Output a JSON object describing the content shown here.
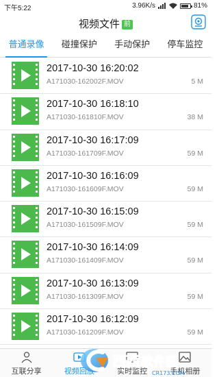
{
  "status_bar": {
    "time": "下午5:22",
    "speed": "3.96K/s",
    "battery": "81%",
    "battery_level": 0.81
  },
  "header": {
    "title": "视频文件",
    "badge": "前",
    "camera_icon": "camera-switch-icon"
  },
  "tabs": [
    {
      "label": "普通录像",
      "active": true
    },
    {
      "label": "碰撞保护",
      "active": false
    },
    {
      "label": "手动保护",
      "active": false
    },
    {
      "label": "停车监控",
      "active": false
    }
  ],
  "videos": [
    {
      "datetime": "2017-10-30 16:20:02",
      "filename": "A171030-162002F.MOV",
      "size": "5 M"
    },
    {
      "datetime": "2017-10-30 16:18:10",
      "filename": "A171030-161810F.MOV",
      "size": "38 M"
    },
    {
      "datetime": "2017-10-30 16:17:09",
      "filename": "A171030-161709F.MOV",
      "size": "59 M"
    },
    {
      "datetime": "2017-10-30 16:16:09",
      "filename": "A171030-161609F.MOV",
      "size": "59 M"
    },
    {
      "datetime": "2017-10-30 16:15:09",
      "filename": "A171030-161509F.MOV",
      "size": "59 M"
    },
    {
      "datetime": "2017-10-30 16:14:09",
      "filename": "A171030-161409F.MOV",
      "size": "59 M"
    },
    {
      "datetime": "2017-10-30 16:13:09",
      "filename": "A171030-161309F.MOV",
      "size": "59 M"
    },
    {
      "datetime": "2017-10-30 16:12:09",
      "filename": "A171030-161209F.MOV",
      "size": "59 M"
    }
  ],
  "bottom_nav": [
    {
      "label": "互联分享",
      "icon": "person-icon",
      "active": false
    },
    {
      "label": "视频回放",
      "icon": "playback-icon",
      "active": true
    },
    {
      "label": "实时监控",
      "icon": "monitor-icon",
      "active": false
    },
    {
      "label": "手机相册",
      "icon": "album-icon",
      "active": false
    }
  ],
  "watermark": {
    "logo_text": "西西软件园",
    "url": "CR173.COM"
  },
  "colors": {
    "accent": "#1e96e8",
    "thumb_green": "#4cb94c",
    "badge_green": "#4fc34f"
  }
}
